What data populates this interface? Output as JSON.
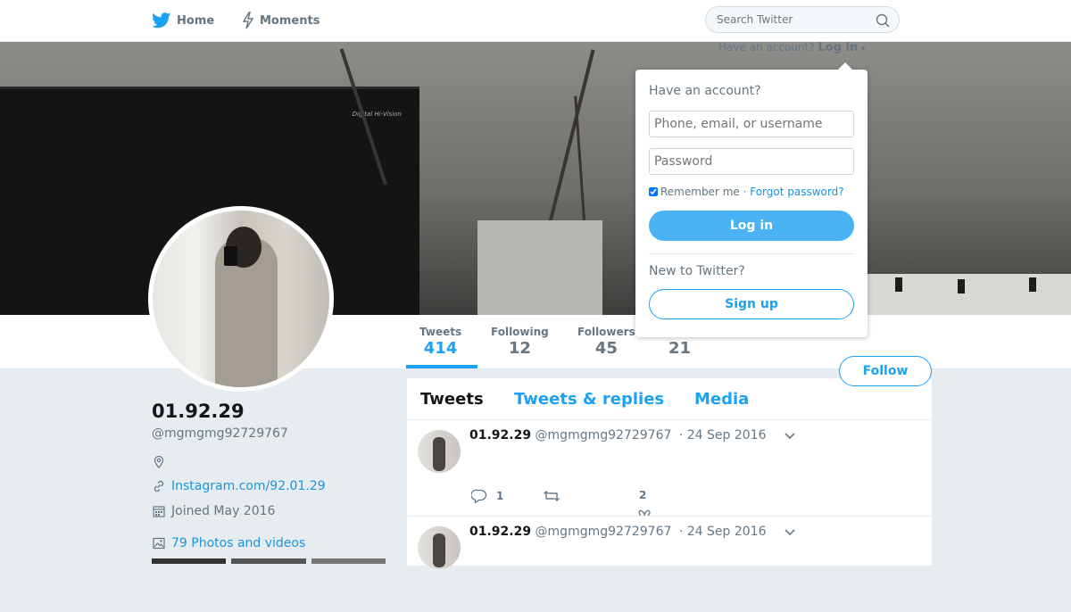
{
  "nav": {
    "home_label": "Home",
    "moments_label": "Moments",
    "search_placeholder": "Search Twitter"
  },
  "banner": {
    "tv_text": "Digital Hi-Vision"
  },
  "login_hint": {
    "prompt": "Have an account?",
    "link": "Log in"
  },
  "stats": [
    {
      "label": "Tweets",
      "value": "414",
      "active": true
    },
    {
      "label": "Following",
      "value": "12"
    },
    {
      "label": "Followers",
      "value": "45"
    },
    {
      "label": "",
      "value": "21"
    }
  ],
  "follow_label": "Follow",
  "profile": {
    "name": "01.92.29",
    "handle": "@mgmgmg92729767",
    "website": "Instagram.com/92.01.29",
    "joined": "Joined May 2016",
    "media": "79 Photos and videos"
  },
  "timeline": {
    "tabs": [
      "Tweets",
      "Tweets & replies",
      "Media"
    ],
    "tweets": [
      {
        "name": "01.92.29",
        "handle": "@mgmgmg92729767",
        "date": "· 24 Sep 2016",
        "replies": "1",
        "retweets": "",
        "likes": "2"
      },
      {
        "name": "01.92.29",
        "handle": "@mgmgmg92729767",
        "date": "· 24 Sep 2016"
      }
    ]
  },
  "dropdown": {
    "title": "Have an account?",
    "username_placeholder": "Phone, email, or username",
    "password_placeholder": "Password",
    "remember": "Remember me",
    "separator": " · ",
    "forgot": "Forgot password?",
    "login_button": "Log in",
    "new_prompt": "New to Twitter?",
    "signup_button": "Sign up"
  },
  "colors": {
    "accent": "#1da1f2",
    "background": "#e6ecf0"
  }
}
